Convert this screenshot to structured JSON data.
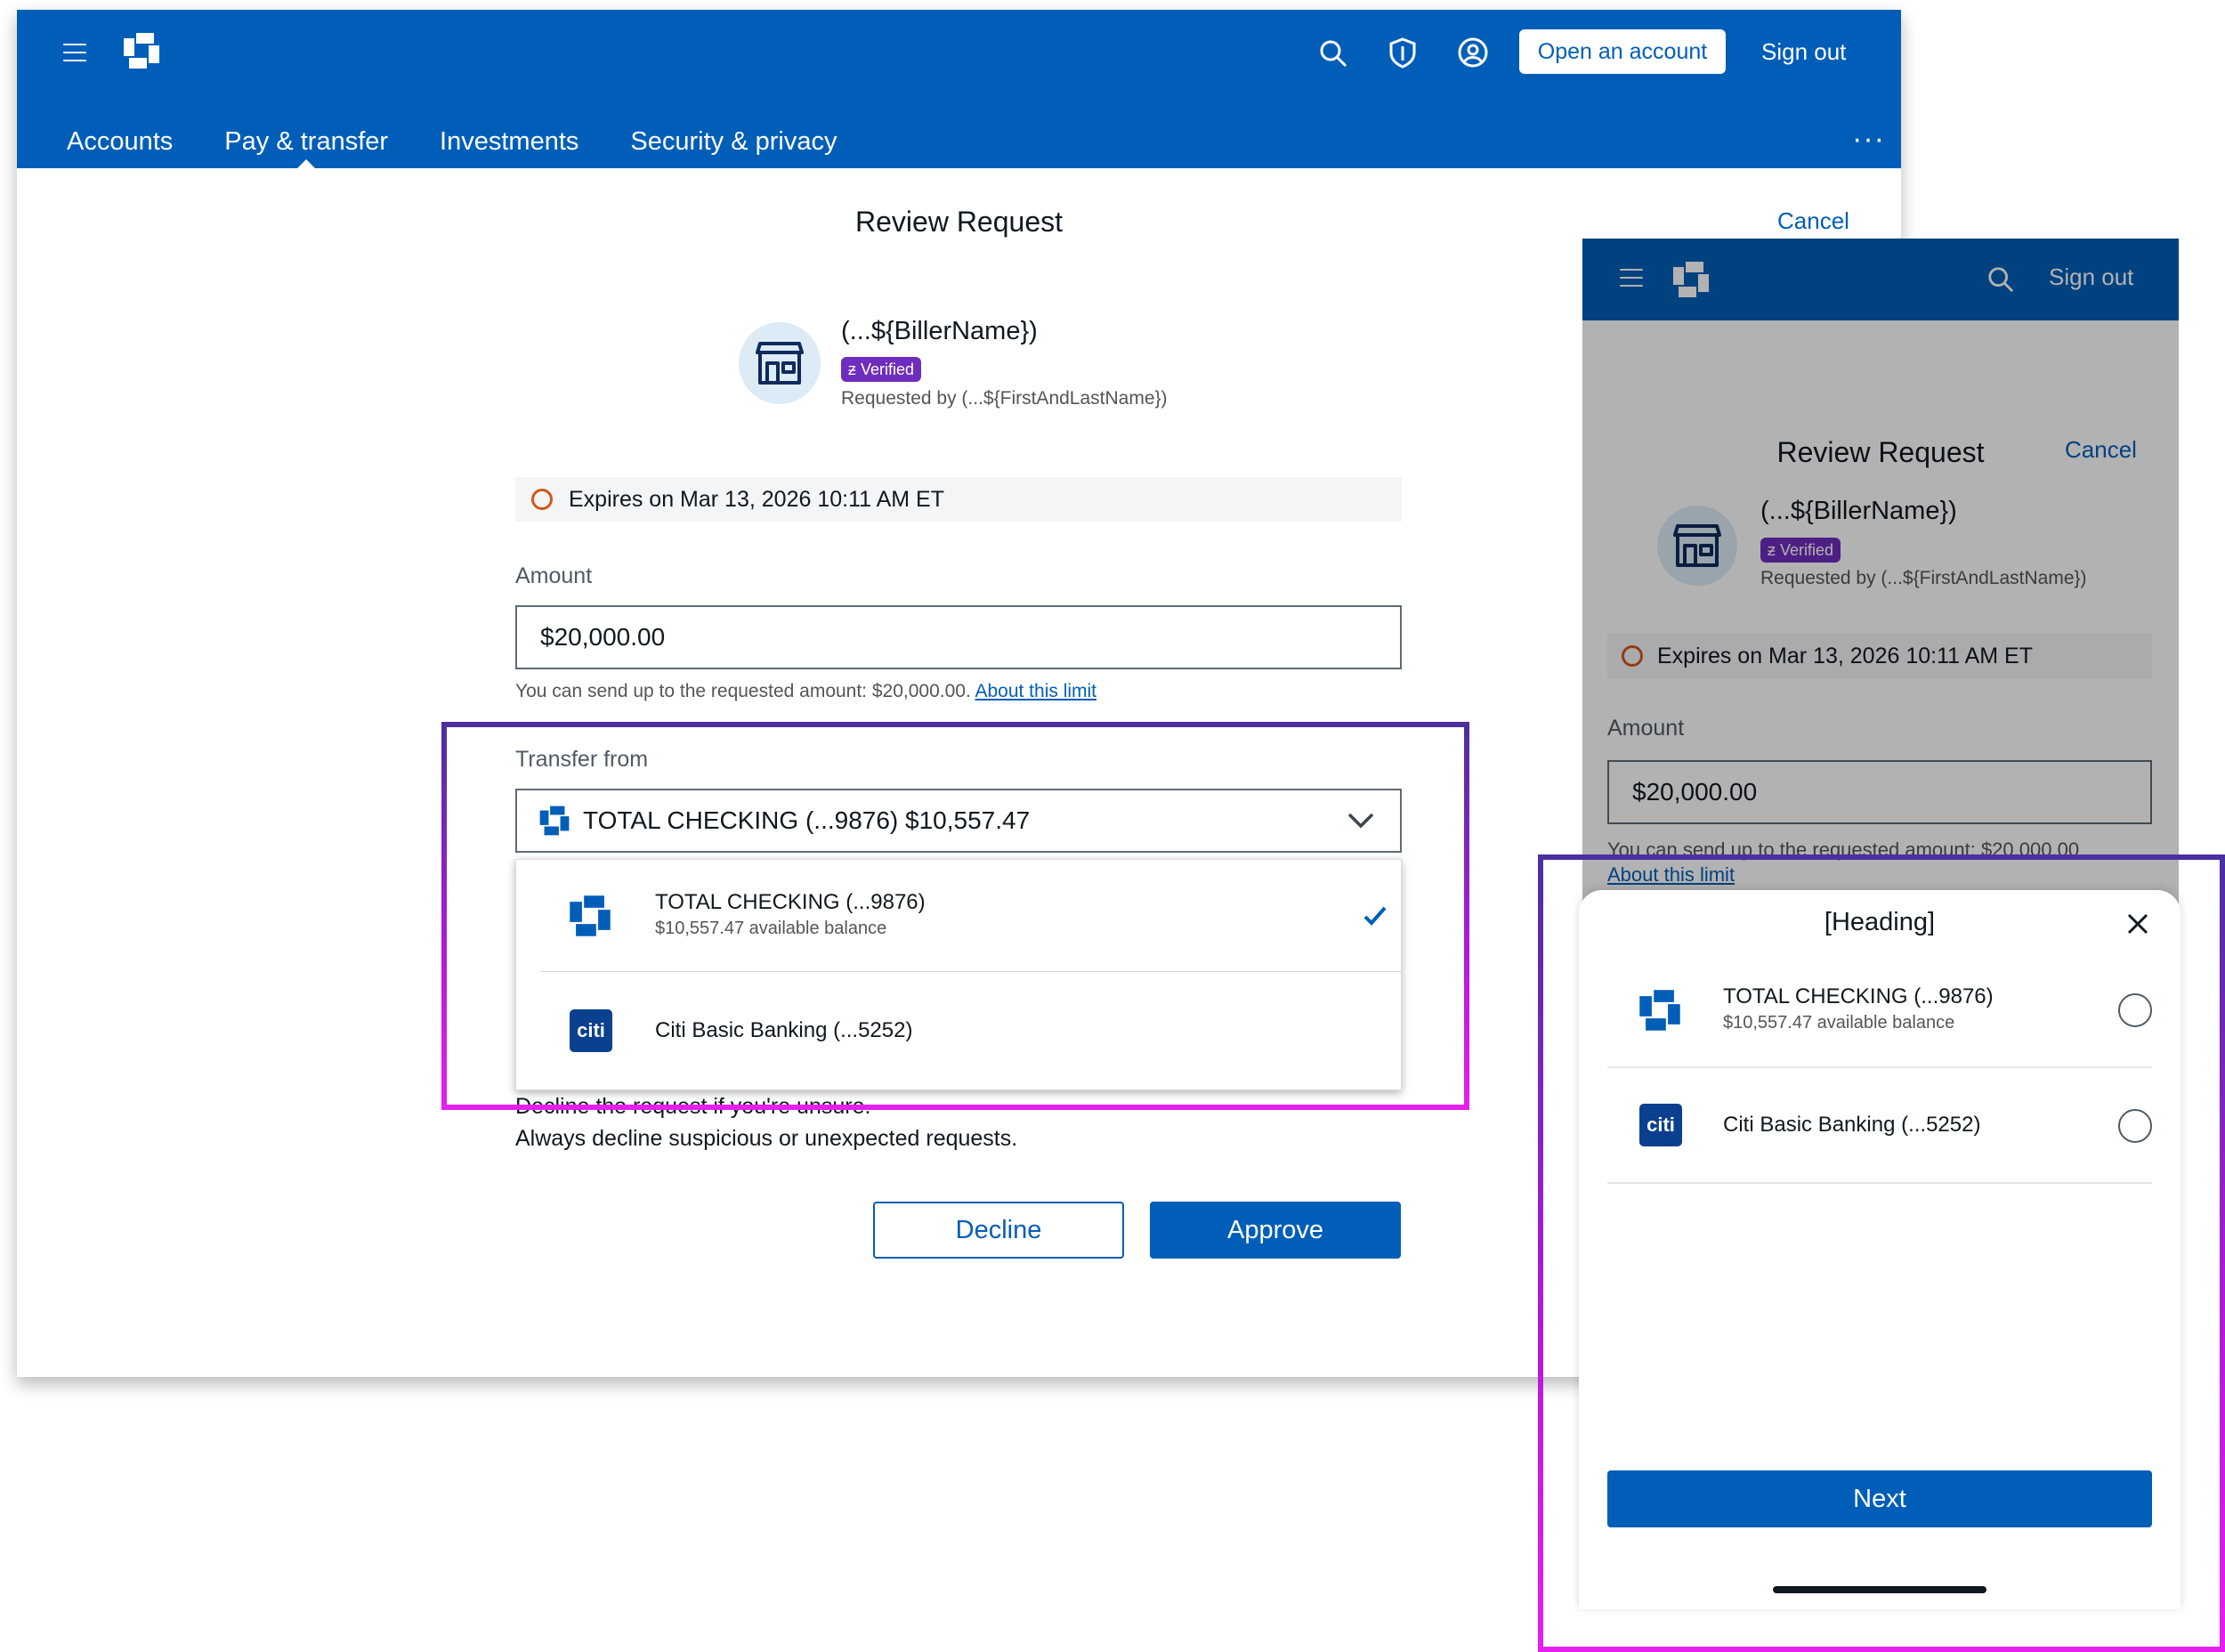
{
  "desktop": {
    "header": {
      "open_account": "Open an account",
      "sign_out": "Sign out",
      "icons": [
        "menu-icon",
        "chase-logo",
        "search-icon",
        "shield-icon",
        "profile-icon",
        "more-icon"
      ]
    },
    "nav": {
      "tabs": [
        {
          "label": "Accounts",
          "active": false
        },
        {
          "label": "Pay & transfer",
          "active": true
        },
        {
          "label": "Investments",
          "active": false
        },
        {
          "label": "Security & privacy",
          "active": false
        }
      ],
      "more": "···"
    },
    "page": {
      "title": "Review Request",
      "cancel": "Cancel",
      "biller_name": "(...${BillerName})",
      "verified_badge": "Verified",
      "requested_by": "Requested by (...${FirstAndLastName})",
      "expires": "Expires on Mar 13, 2026 10:11 AM ET",
      "amount_label": "Amount",
      "amount_value": "$20,000.00",
      "helper_text": "You can send up to the requested amount: $20,000.00. ",
      "helper_link": "About this limit",
      "transfer_label": "Transfer from",
      "selected_account": "TOTAL CHECKING (...9876) $10,557.47",
      "warning_title": "Decline the request if you're unsure.",
      "warning_body": "Always decline suspicious or unexpected requests.",
      "decline": "Decline",
      "approve": "Approve"
    },
    "dropdown": {
      "options": [
        {
          "title": "TOTAL CHECKING (...9876)",
          "subtitle": "$10,557.47 available balance",
          "selected": true
        },
        {
          "title": "Citi Basic Banking (...5252)",
          "subtitle": "",
          "selected": false
        }
      ]
    }
  },
  "mobile": {
    "sign_out": "Sign out",
    "title": "Review Request",
    "cancel": "Cancel",
    "biller_name": "(...${BillerName})",
    "verified_badge": "Verified",
    "requested_by": "Requested by (...${FirstAndLastName})",
    "expires": "Expires on Mar 13, 2026 10:11 AM ET",
    "amount_label": "Amount",
    "amount_value": "$20,000.00",
    "helper_text": "You can send up to the requested amount: $20,000.00",
    "helper_link": "About this limit",
    "sheet": {
      "heading": "[Heading]",
      "options": [
        {
          "title": "TOTAL CHECKING (...9876)",
          "subtitle": "$10,557.47 available balance"
        },
        {
          "title": "Citi Basic Banking (...5252)",
          "subtitle": ""
        }
      ],
      "next": "Next"
    }
  },
  "citi_logo_text": "citi",
  "colors": {
    "brand_blue": "#005eb8",
    "verified_purple": "#6f2dbd",
    "expire_ring": "#d4561b",
    "annotation_gradient": [
      "#4b2fa0",
      "#e61ef0"
    ]
  }
}
